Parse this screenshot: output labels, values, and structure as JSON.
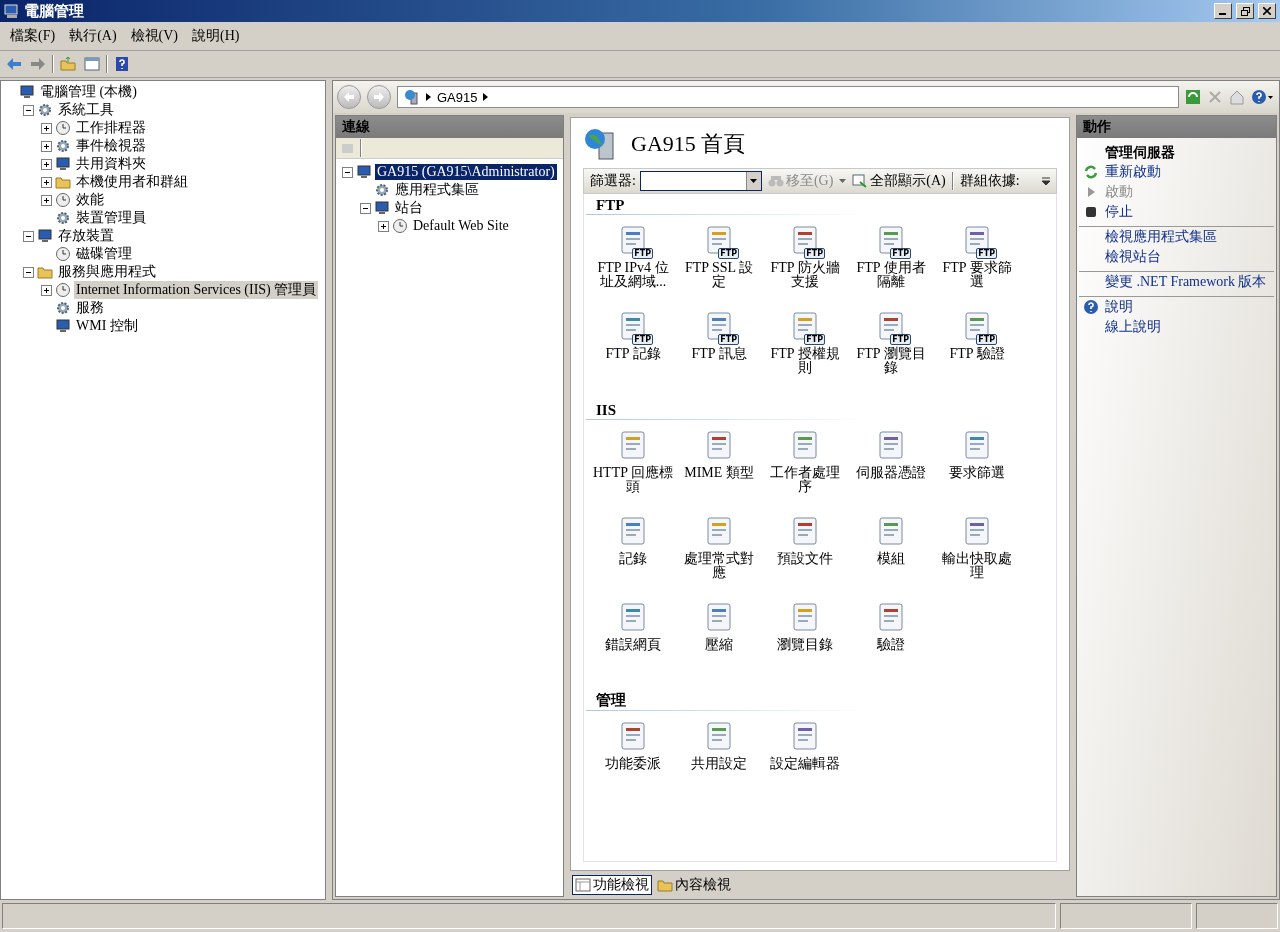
{
  "window": {
    "title": "電腦管理"
  },
  "menu": [
    "檔案(F)",
    "執行(A)",
    "檢視(V)",
    "說明(H)"
  ],
  "tree": [
    {
      "label": "電腦管理 (本機)",
      "selected": false,
      "children": [
        {
          "label": "系統工具",
          "expanded": true,
          "selected": false,
          "children": [
            {
              "label": "工作排程器",
              "expanded": false,
              "selected": false
            },
            {
              "label": "事件檢視器",
              "expanded": false,
              "selected": false
            },
            {
              "label": "共用資料夾",
              "expanded": false,
              "selected": false
            },
            {
              "label": "本機使用者和群組",
              "expanded": false,
              "selected": false
            },
            {
              "label": "效能",
              "expanded": false,
              "selected": false
            },
            {
              "label": "裝置管理員",
              "selected": false
            }
          ]
        },
        {
          "label": "存放裝置",
          "expanded": true,
          "selected": false,
          "children": [
            {
              "label": "磁碟管理",
              "selected": false
            }
          ]
        },
        {
          "label": "服務與應用程式",
          "expanded": true,
          "selected": false,
          "children": [
            {
              "label": "Internet Information Services (IIS) 管理員",
              "expanded": false,
              "selected": true
            },
            {
              "label": "服務",
              "selected": false
            },
            {
              "label": "WMI 控制",
              "selected": false
            }
          ]
        }
      ]
    }
  ],
  "address": {
    "crumbs": [
      "GA915"
    ]
  },
  "connections": {
    "title": "連線",
    "tree": [
      {
        "label": "GA915 (GA915\\Administrator)",
        "expanded": true,
        "selected": true,
        "children": [
          {
            "label": "應用程式集區",
            "selected": false
          },
          {
            "label": "站台",
            "expanded": true,
            "selected": false,
            "children": [
              {
                "label": "Default Web Site",
                "expanded": false,
                "selected": false
              }
            ]
          }
        ]
      }
    ]
  },
  "features": {
    "title": "GA915 首頁",
    "filter": {
      "label": "篩選器:",
      "go": "移至(G)",
      "show_all": "全部顯示(A)",
      "group_by": "群組依據:"
    },
    "sections": [
      {
        "title": "FTP",
        "items": [
          {
            "label": "FTP IPv4 位址及網域...",
            "badge": "FTP"
          },
          {
            "label": "FTP SSL 設定",
            "badge": "FTP"
          },
          {
            "label": "FTP 防火牆支援",
            "badge": "FTP"
          },
          {
            "label": "FTP 使用者隔離",
            "badge": "FTP"
          },
          {
            "label": "FTP 要求篩選",
            "badge": "FTP"
          },
          {
            "label": "FTP 記錄",
            "badge": "FTP"
          },
          {
            "label": "FTP 訊息",
            "badge": "FTP"
          },
          {
            "label": "FTP 授權規則",
            "badge": "FTP"
          },
          {
            "label": "FTP 瀏覽目錄",
            "badge": "FTP"
          },
          {
            "label": "FTP 驗證",
            "badge": "FTP"
          }
        ]
      },
      {
        "title": "IIS",
        "items": [
          {
            "label": "HTTP 回應標頭"
          },
          {
            "label": "MIME 類型"
          },
          {
            "label": "工作者處理序"
          },
          {
            "label": "伺服器憑證"
          },
          {
            "label": "要求篩選"
          },
          {
            "label": "記錄"
          },
          {
            "label": "處理常式對應"
          },
          {
            "label": "預設文件"
          },
          {
            "label": "模組"
          },
          {
            "label": "輸出快取處理"
          },
          {
            "label": "錯誤網頁"
          },
          {
            "label": "壓縮"
          },
          {
            "label": "瀏覽目錄"
          },
          {
            "label": "驗證"
          }
        ]
      },
      {
        "title": "管理",
        "items": [
          {
            "label": "功能委派"
          },
          {
            "label": "共用設定"
          },
          {
            "label": "設定編輯器"
          }
        ]
      }
    ],
    "views": [
      {
        "label": "功能檢視",
        "selected": true
      },
      {
        "label": "內容檢視",
        "selected": false
      }
    ]
  },
  "actions": {
    "title": "動作",
    "groups": [
      [
        {
          "kind": "heading",
          "label": "管理伺服器"
        },
        {
          "kind": "restart",
          "label": "重新啟動",
          "disabled": false
        },
        {
          "kind": "start",
          "label": "啟動",
          "disabled": true
        },
        {
          "kind": "stop",
          "label": "停止",
          "disabled": false
        }
      ],
      [
        {
          "kind": "link",
          "label": "檢視應用程式集區",
          "disabled": false
        },
        {
          "kind": "link",
          "label": "檢視站台",
          "disabled": false
        }
      ],
      [
        {
          "kind": "link",
          "label": "變更 .NET Framework 版本",
          "disabled": false
        }
      ],
      [
        {
          "kind": "help",
          "label": "說明",
          "disabled": false
        },
        {
          "kind": "link",
          "label": "線上說明",
          "disabled": false
        }
      ]
    ]
  }
}
